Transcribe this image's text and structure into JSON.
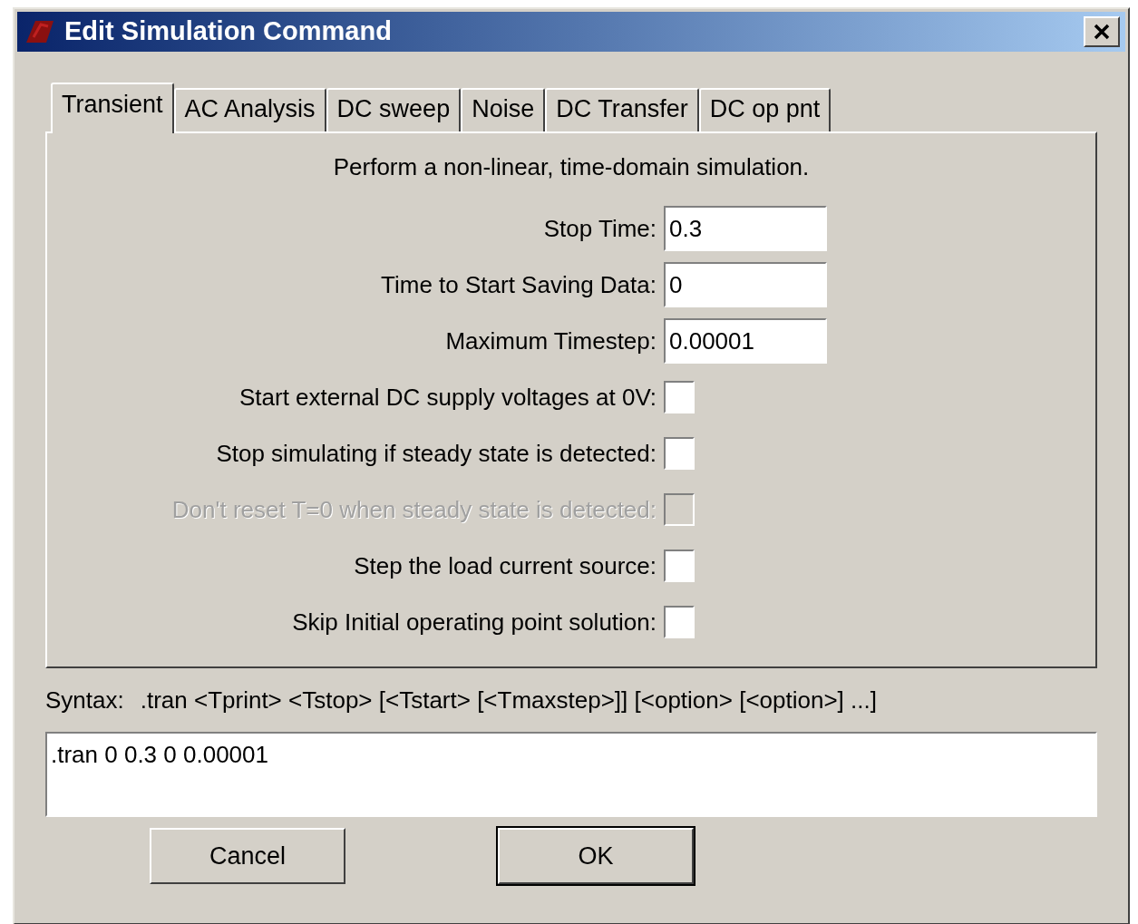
{
  "window": {
    "title": "Edit Simulation Command"
  },
  "tabs": [
    {
      "label": "Transient",
      "selected": true
    },
    {
      "label": "AC Analysis",
      "selected": false
    },
    {
      "label": "DC sweep",
      "selected": false
    },
    {
      "label": "Noise",
      "selected": false
    },
    {
      "label": "DC Transfer",
      "selected": false
    },
    {
      "label": "DC op pnt",
      "selected": false
    }
  ],
  "description": "Perform a non-linear, time-domain simulation.",
  "fields": [
    {
      "kind": "text",
      "label": "Stop Time:",
      "value": "0.3"
    },
    {
      "kind": "text",
      "label": "Time to Start Saving Data:",
      "value": "0"
    },
    {
      "kind": "text",
      "label": "Maximum Timestep:",
      "value": "0.00001"
    },
    {
      "kind": "checkbox",
      "label": "Start external DC supply voltages at 0V:",
      "checked": false,
      "disabled": false
    },
    {
      "kind": "checkbox",
      "label": "Stop simulating if steady state is detected:",
      "checked": false,
      "disabled": false
    },
    {
      "kind": "checkbox",
      "label": "Don't reset T=0 when steady state is detected:",
      "checked": false,
      "disabled": true
    },
    {
      "kind": "checkbox",
      "label": "Step the load current source:",
      "checked": false,
      "disabled": false
    },
    {
      "kind": "checkbox",
      "label": "Skip Initial operating point solution:",
      "checked": false,
      "disabled": false
    }
  ],
  "syntax": {
    "label": "Syntax:",
    "text": ".tran <Tprint> <Tstop> [<Tstart> [<Tmaxstep>]] [<option> [<option>] ...]"
  },
  "command": ".tran 0 0.3 0 0.00001",
  "buttons": [
    {
      "label": "Cancel",
      "default": false
    },
    {
      "label": "OK",
      "default": true
    }
  ]
}
